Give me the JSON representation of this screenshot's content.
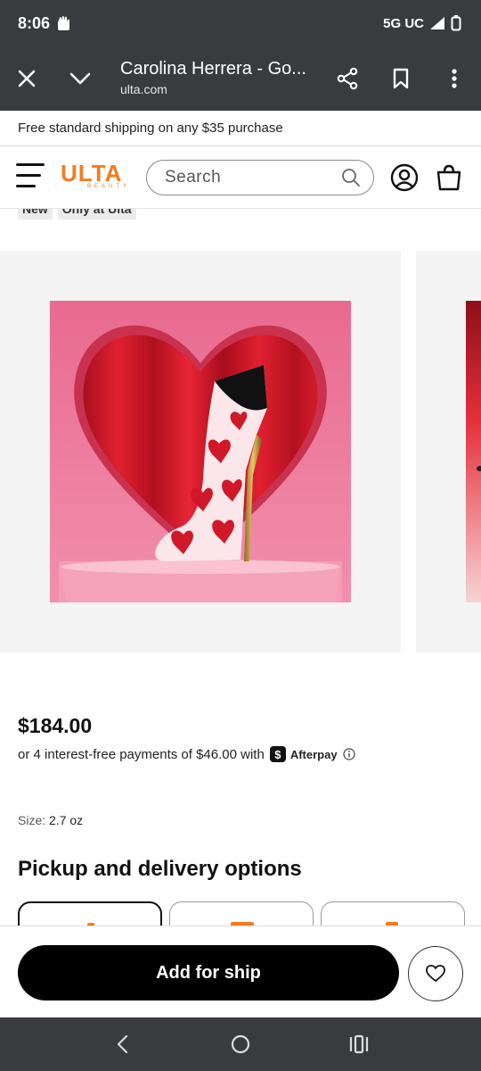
{
  "status_bar": {
    "time": "8:06",
    "network": "5G UC"
  },
  "browser": {
    "page_title": "Carolina Herrera - Go...",
    "url": "ulta.com"
  },
  "banner": {
    "text": "Free standard shipping on any $35 purchase"
  },
  "header": {
    "logo_text": "ULTA",
    "logo_subtext": "BEAUTY",
    "search_placeholder": "Search"
  },
  "tags": [
    "New",
    "Only at Ulta"
  ],
  "product": {
    "price": "$184.00",
    "installment_text": "or 4 interest-free payments of $46.00 with",
    "afterpay_label": "Afterpay",
    "size_label": "Size:",
    "size_value": "2.7 oz"
  },
  "pickup": {
    "title": "Pickup and delivery options"
  },
  "actions": {
    "add_label": "Add for ship"
  },
  "colors": {
    "brand_orange": "#f47b20",
    "chrome_dark": "#3a3b3e"
  }
}
